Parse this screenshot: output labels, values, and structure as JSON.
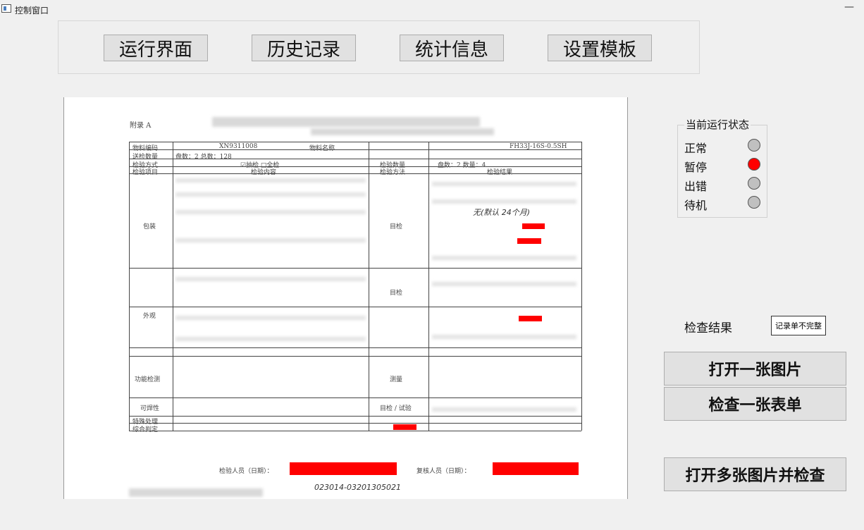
{
  "window": {
    "title": "控制窗口",
    "minimize_label": "—"
  },
  "nav": {
    "run": "运行界面",
    "history": "历史记录",
    "stats": "统计信息",
    "template": "设置模板"
  },
  "document": {
    "appendix": "附录 A",
    "row_material_code_label": "物料编码",
    "material_code": "XN9311008",
    "row_material_name_label": "物料名称",
    "part_no": "FH33J-16S-0.5SH",
    "row_qty_label": "送检数量",
    "qty_text": "盘数：2  总数：128",
    "inspect_method_label": "检验方式",
    "inspect_method": "☑抽检  □全检",
    "inspect_qty_label": "检验数量",
    "inspect_qty": "盘数：2    数量：4",
    "col_item": "检验项目",
    "col_content": "检验内容",
    "col_method": "检验方法",
    "col_result": "检验结果",
    "cat_packaging": "包装",
    "cat_appearance": "外观",
    "cat_function": "功能检测",
    "cat_solderability": "可焊性",
    "cat_special": "特殊处理",
    "cat_overall": "综合判定",
    "method_visual": "目检",
    "method_measure": "测量",
    "method_visual_test": "目检 / 试验",
    "handwriting_date": "无(默认 24个月)",
    "signature_code": "023014-03201305021",
    "inspector_label": "检验人员（日期）：",
    "reviewer_label": "复核人员（日期）："
  },
  "status": {
    "title": "当前运行状态",
    "items": [
      {
        "label": "正常",
        "color": "#c0c0c0",
        "active": false
      },
      {
        "label": "暂停",
        "color": "#ff0000",
        "active": true
      },
      {
        "label": "出错",
        "color": "#c0c0c0",
        "active": false
      },
      {
        "label": "待机",
        "color": "#c0c0c0",
        "active": false
      }
    ]
  },
  "result": {
    "label": "检查结果",
    "value": "记录单不完整"
  },
  "actions": {
    "open_one": "打开一张图片",
    "check_one": "检查一张表单",
    "open_many": "打开多张图片并检查"
  }
}
